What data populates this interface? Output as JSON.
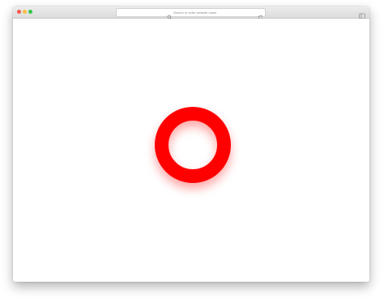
{
  "window": {
    "traffic_lights": {
      "close_color": "#fc5753",
      "minimize_color": "#fdbc40",
      "maximize_color": "#33c748"
    }
  },
  "address_bar": {
    "placeholder": "Search or enter website name",
    "search_icon": "search-icon",
    "reload_icon": "reload-icon"
  },
  "toolbar": {
    "sidebar_icon": "sidebar-icon"
  },
  "content": {
    "spinner": {
      "shape": "ring",
      "color": "#ff0000"
    }
  }
}
